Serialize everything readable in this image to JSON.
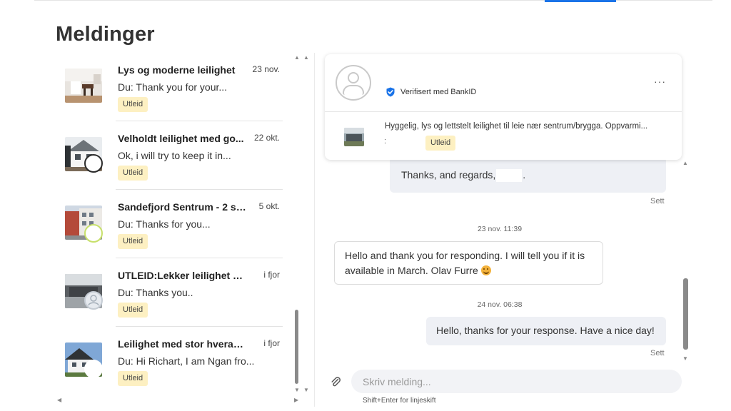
{
  "page": {
    "title": "Meldinger"
  },
  "conversations": [
    {
      "title": "Lys og moderne leilighet",
      "date": "23 nov.",
      "preview": "Du: Thank you for your...",
      "badge": "Utleid"
    },
    {
      "title": "Velholdt leilighet med go...",
      "date": "22 okt.",
      "preview": "Ok, i will try to keep it in...",
      "badge": "Utleid"
    },
    {
      "title": "Sandefjord Sentrum - 2 so...",
      "date": "5 okt.",
      "preview": "Du: Thanks for you...",
      "badge": "Utleid"
    },
    {
      "title": "UTLEID:Lekker leilighet 97 ...",
      "date": "i fjor",
      "preview": "Du: Thanks you..",
      "badge": "Utleid"
    },
    {
      "title": "Leilighet med stor hverand...",
      "date": "i fjor",
      "preview": "Du: Hi Richart, I am Ngan fro...",
      "badge": "Utleid"
    }
  ],
  "chat": {
    "header": {
      "verified": "Verifisert med BankID",
      "more": "···",
      "listing_text": "Hyggelig, lys og lettstelt leilighet til leie nær sentrum/brygga. Oppvarmi...",
      "listing_dot": ":",
      "badge": "Utleid"
    },
    "messages": [
      {
        "text": "Thanks, and regards,",
        "suffix": ".",
        "seen": "Sett"
      },
      {
        "timestamp": "23 nov. 11:39"
      },
      {
        "text": "Hello and thank you for responding. I will tell you if it is available in March. Olav Furre"
      },
      {
        "timestamp": "24 nov. 06:38"
      },
      {
        "text": "Hello, thanks for your response. Have a nice day!",
        "seen": "Sett"
      }
    ]
  },
  "composer": {
    "placeholder": "Skriv melding...",
    "hint": "Shift+Enter for linjeskift"
  },
  "icons": {
    "verified": "verified-check-icon",
    "attach": "paperclip-icon",
    "more": "more-options-icon"
  },
  "colors": {
    "badge_bg": "#fdf0c2",
    "outgoing_bubble": "#eef0f5",
    "verified_blue": "#1a73e8",
    "accent_tab": "#1a73e8"
  }
}
